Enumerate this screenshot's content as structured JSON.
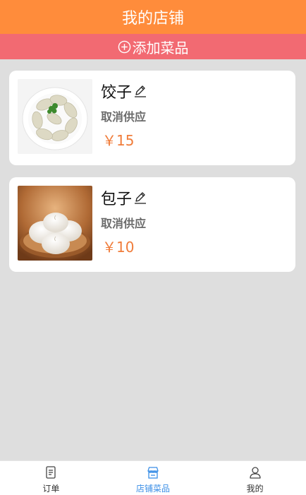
{
  "header": {
    "title": "我的店铺"
  },
  "add_bar": {
    "label": "添加菜品"
  },
  "dishes": [
    {
      "name": "饺子",
      "action": "取消供应",
      "price": "￥15",
      "image": "dumplings"
    },
    {
      "name": "包子",
      "action": "取消供应",
      "price": "￥10",
      "image": "steamed-buns"
    }
  ],
  "tabbar": {
    "items": [
      {
        "label": "订单",
        "icon": "document-icon",
        "active": false
      },
      {
        "label": "店铺菜品",
        "icon": "shop-icon",
        "active": true
      },
      {
        "label": "我的",
        "icon": "user-icon",
        "active": false
      }
    ]
  },
  "colors": {
    "header_bg": "#ff8c3b",
    "add_bar_bg": "#f26a72",
    "price": "#f07c3a",
    "tab_active": "#3a8ee6",
    "page_bg": "#dedede"
  }
}
